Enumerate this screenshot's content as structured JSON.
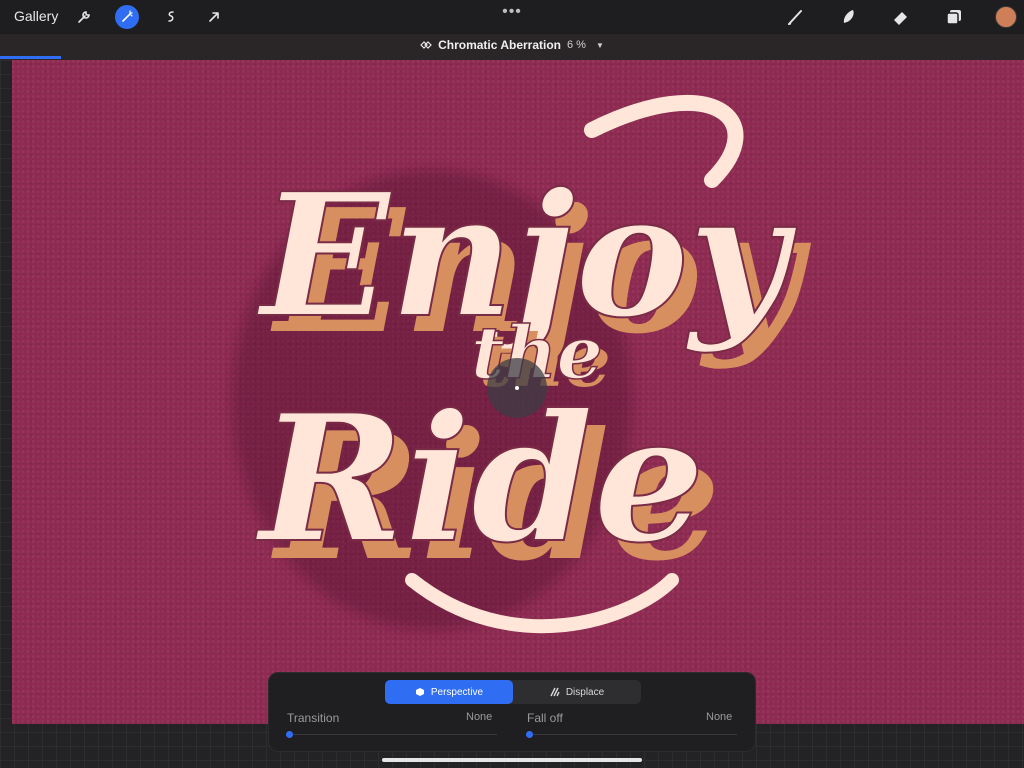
{
  "toolbar": {
    "gallery_label": "Gallery",
    "more_label": "•••",
    "left_tools": [
      "wrench-icon",
      "magic-wand-icon",
      "selection-icon",
      "transform-arrow-icon"
    ],
    "right_tools": [
      "brush-icon",
      "smudge-icon",
      "eraser-icon",
      "layers-icon"
    ],
    "active_color": "#cf7f57",
    "accent": "#2f6df2"
  },
  "adjustment": {
    "title": "Chromatic Aberration",
    "percent": "6 %",
    "progress_fraction": 0.06
  },
  "canvas": {
    "background_color": "#8f2b52",
    "artwork_lines": [
      "Enjoy",
      "the",
      "Ride"
    ]
  },
  "panel": {
    "modes": [
      {
        "label": "Perspective",
        "active": true
      },
      {
        "label": "Displace",
        "active": false
      }
    ],
    "sliders": [
      {
        "label": "Transition",
        "value": "None",
        "fraction": 0
      },
      {
        "label": "Fall off",
        "value": "None",
        "fraction": 0
      }
    ]
  }
}
